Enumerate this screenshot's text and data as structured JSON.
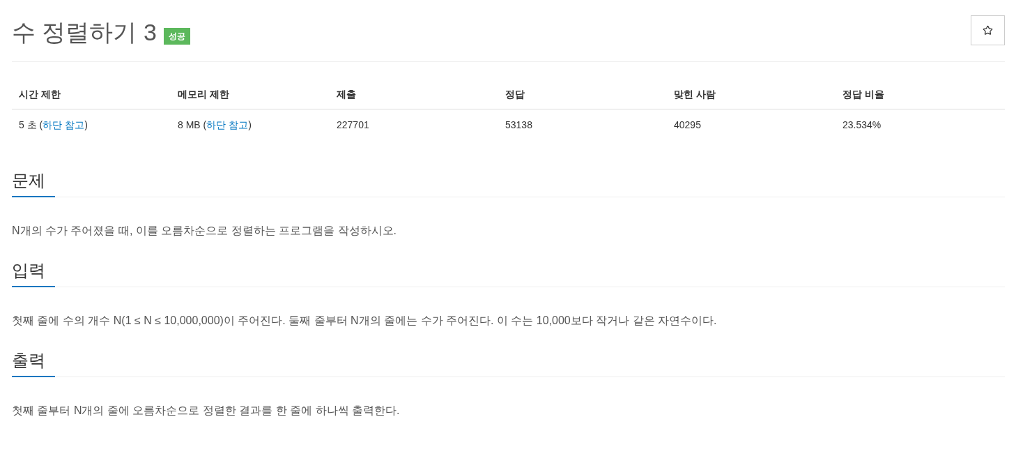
{
  "title": "수 정렬하기 3",
  "badge": "성공",
  "table": {
    "columns": [
      "시간 제한",
      "메모리 제한",
      "제출",
      "정답",
      "맞힌 사람",
      "정답 비율"
    ],
    "rows": [
      [
        [
          {
            "text": "5 초 ("
          },
          {
            "link": "하단 참고"
          },
          {
            "text": ")"
          }
        ],
        [
          {
            "text": "8 MB ("
          },
          {
            "link": "하단 참고"
          },
          {
            "text": ")"
          }
        ],
        [
          {
            "text": "227701"
          }
        ],
        [
          {
            "text": "53138"
          }
        ],
        [
          {
            "text": "40295"
          }
        ],
        [
          {
            "text": "23.534%"
          }
        ]
      ]
    ]
  },
  "sections": [
    {
      "heading": "문제",
      "text": "N개의 수가 주어졌을 때, 이를 오름차순으로 정렬하는 프로그램을 작성하시오."
    },
    {
      "heading": "입력",
      "text": "첫째 줄에 수의 개수 N(1 ≤ N ≤ 10,000,000)이 주어진다. 둘째 줄부터 N개의 줄에는 수가 주어진다. 이 수는 10,000보다 작거나 같은 자연수이다."
    },
    {
      "heading": "출력",
      "text": "첫째 줄부터 N개의 줄에 오름차순으로 정렬한 결과를 한 줄에 하나씩 출력한다."
    }
  ]
}
